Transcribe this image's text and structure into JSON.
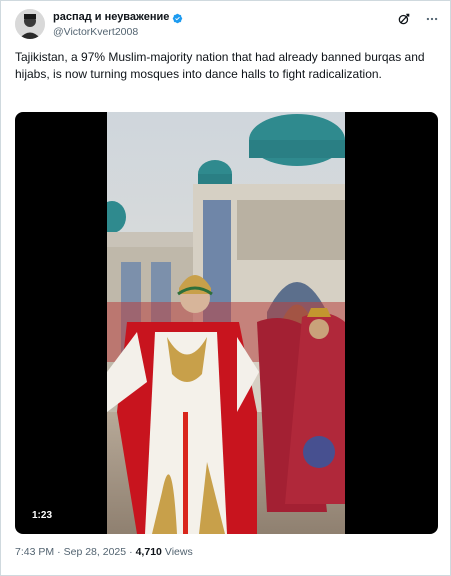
{
  "author": {
    "display_name": "распад и неуважение",
    "handle": "@VictorKvert2008",
    "verified": true
  },
  "tweet": {
    "text": "Tajikistan, a 97% Muslim-majority nation that had already banned burqas and hijabs, is now turning mosques into dance halls to fight radicalization."
  },
  "media": {
    "type": "video",
    "duration": "1:23"
  },
  "meta": {
    "time": "7:43 PM",
    "date": "Sep 28, 2025",
    "views_count": "4,710",
    "views_label": "Views",
    "separator": "·"
  },
  "icons": {
    "grok": "grok-icon",
    "more": "more-icon",
    "verified": "verified-badge-icon"
  },
  "colors": {
    "verified_blue": "#1d9bf0",
    "secondary_text": "#536471",
    "primary_text": "#0f1419",
    "border": "#cfd9de"
  }
}
